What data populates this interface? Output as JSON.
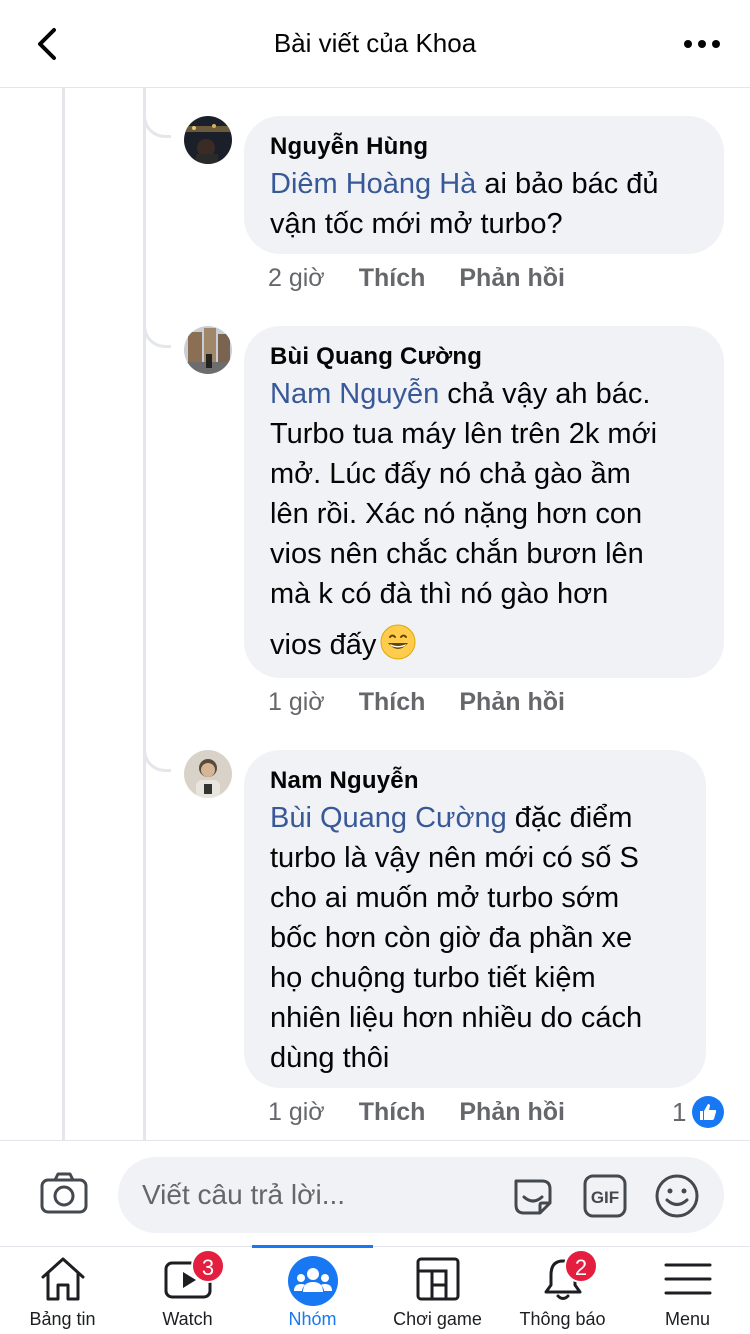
{
  "header": {
    "title": "Bài viết của Khoa"
  },
  "comments": [
    {
      "author": "Nguyễn Hùng",
      "mention": "Diêm Hoàng Hà",
      "line1_rest": " ai bảo bác đủ",
      "lines": [
        "vận tốc mới mở turbo?"
      ],
      "time": "2 giờ",
      "like_label": "Thích",
      "reply_label": "Phản hồi"
    },
    {
      "author": "Bùi Quang Cường",
      "mention": "Nam Nguyễn",
      "line1_rest": " chả vậy ah bác.",
      "lines": [
        "Turbo tua máy lên trên 2k mới",
        "mở. Lúc đấy nó chả gào ầm",
        "lên rồi. Xác nó nặng hơn con",
        "vios nên chắc chắn bươn lên",
        "mà k có đà thì nó gào hơn",
        "vios đấy"
      ],
      "emoji": "grinning-face-emoji",
      "time": "1 giờ",
      "like_label": "Thích",
      "reply_label": "Phản hồi"
    },
    {
      "author": "Nam Nguyễn",
      "mention": "Bùi Quang Cường",
      "line1_rest": " đặc điểm",
      "lines": [
        "turbo là vậy nên mới có số S",
        "cho ai muốn mở turbo sớm",
        "bốc hơn còn giờ đa phần xe",
        "họ chuộng turbo tiết kiệm",
        "nhiên liệu hơn nhiều do cách",
        "dùng thôi"
      ],
      "time": "1 giờ",
      "like_label": "Thích",
      "reply_label": "Phản hồi",
      "like_count": "1"
    }
  ],
  "reply_bar": {
    "placeholder": "Viết câu trả lời..."
  },
  "nav": {
    "tabs": [
      {
        "label": "Bảng tin"
      },
      {
        "label": "Watch",
        "badge": "3"
      },
      {
        "label": "Nhóm"
      },
      {
        "label": "Chơi game"
      },
      {
        "label": "Thông báo",
        "badge": "2"
      },
      {
        "label": "Menu"
      }
    ]
  },
  "colors": {
    "accent": "#1877f2",
    "mention": "#385898",
    "badge": "#e41e3f",
    "bubble": "#f0f2f5"
  }
}
